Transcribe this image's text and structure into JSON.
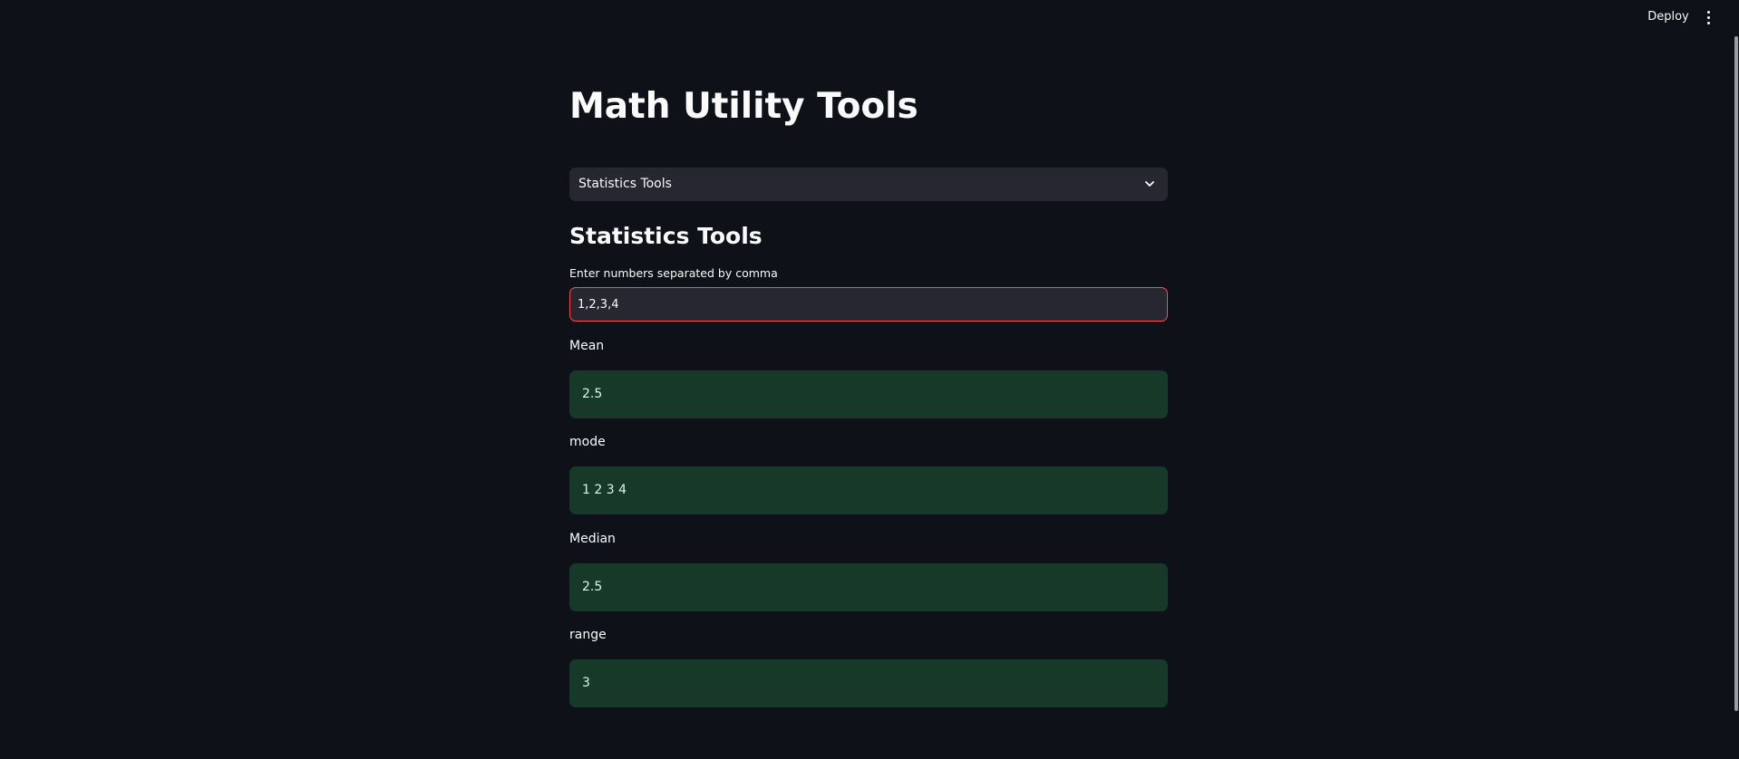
{
  "header": {
    "deploy_label": "Deploy",
    "menu_icon": "kebab-menu-icon"
  },
  "page": {
    "title": "Math Utility Tools"
  },
  "tool_select": {
    "selected": "Statistics Tools",
    "icon": "chevron-down-icon"
  },
  "section": {
    "heading": "Statistics Tools",
    "input_label": "Enter numbers separated by comma",
    "input_value": "1,2,3,4"
  },
  "results": [
    {
      "label": "Mean",
      "value": "2.5"
    },
    {
      "label": "mode",
      "value": "1 2 3 4"
    },
    {
      "label": "Median",
      "value": "2.5"
    },
    {
      "label": "range",
      "value": "3"
    }
  ],
  "colors": {
    "background": "#0e1117",
    "input_background": "#262730",
    "input_focus_border": "#ff4b4b",
    "success_background": "#173928"
  }
}
